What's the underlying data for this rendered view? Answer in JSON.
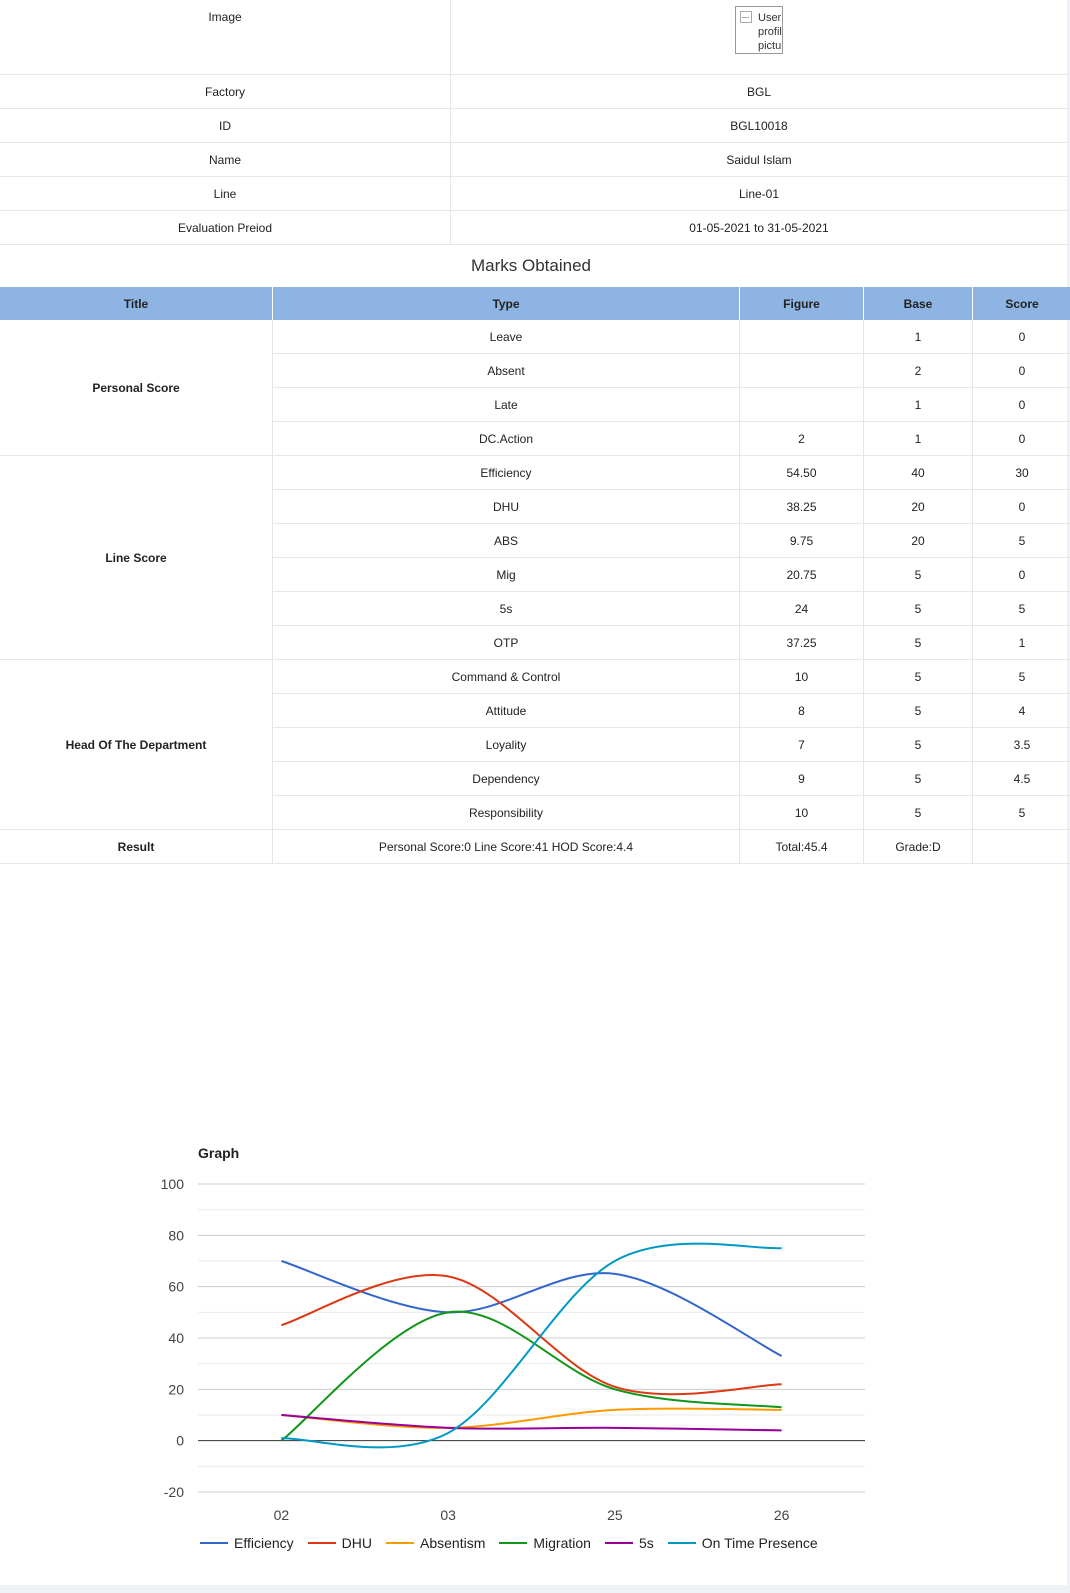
{
  "info": {
    "rows": [
      {
        "key": "Image",
        "value": "User profile picture",
        "image": true
      },
      {
        "key": "Factory",
        "value": "BGL"
      },
      {
        "key": "ID",
        "value": "BGL10018"
      },
      {
        "key": "Name",
        "value": "Saidul Islam"
      },
      {
        "key": "Line",
        "value": "Line-01"
      },
      {
        "key": "Evaluation Preiod",
        "value": "01-05-2021 to 31-05-2021"
      }
    ]
  },
  "marks": {
    "title": "Marks Obtained",
    "headers": [
      "Title",
      "Type",
      "Figure",
      "Base",
      "Score"
    ],
    "groups": [
      {
        "title": "Personal Score",
        "rows": [
          [
            "Leave",
            "",
            "1",
            "0"
          ],
          [
            "Absent",
            "",
            "2",
            "0"
          ],
          [
            "Late",
            "",
            "1",
            "0"
          ],
          [
            "DC.Action",
            "2",
            "1",
            "0"
          ]
        ]
      },
      {
        "title": "Line Score",
        "rows": [
          [
            "Efficiency",
            "54.50",
            "40",
            "30"
          ],
          [
            "DHU",
            "38.25",
            "20",
            "0"
          ],
          [
            "ABS",
            "9.75",
            "20",
            "5"
          ],
          [
            "Mig",
            "20.75",
            "5",
            "0"
          ],
          [
            "5s",
            "24",
            "5",
            "5"
          ],
          [
            "OTP",
            "37.25",
            "5",
            "1"
          ]
        ]
      },
      {
        "title": "Head Of The Department",
        "rows": [
          [
            "Command & Control",
            "10",
            "5",
            "5"
          ],
          [
            "Attitude",
            "8",
            "5",
            "4"
          ],
          [
            "Loyality",
            "7",
            "5",
            "3.5"
          ],
          [
            "Dependency",
            "9",
            "5",
            "4.5"
          ],
          [
            "Responsibility",
            "10",
            "5",
            "5"
          ]
        ]
      }
    ],
    "result": {
      "title": "Result",
      "summary": "Personal Score:0  Line Score:41  HOD Score:4.4",
      "total": "Total:45.4",
      "grade": "Grade:D",
      "score": ""
    }
  },
  "chart_data": {
    "type": "line",
    "title": "Graph",
    "xlabel": "",
    "ylabel": "",
    "categories": [
      "02",
      "03",
      "25",
      "26"
    ],
    "ylim": [
      -20,
      100
    ],
    "yticks": [
      -20,
      0,
      20,
      40,
      60,
      80,
      100
    ],
    "grid": true,
    "smooth": true,
    "legend_position": "bottom",
    "series": [
      {
        "name": "Efficiency",
        "color": "#3366cc",
        "values": [
          70,
          50,
          65,
          33
        ]
      },
      {
        "name": "DHU",
        "color": "#dc3912",
        "values": [
          45,
          64,
          21,
          22
        ]
      },
      {
        "name": "Absentism",
        "color": "#ff9900",
        "values": [
          10,
          5,
          12,
          12
        ]
      },
      {
        "name": "Migration",
        "color": "#109618",
        "values": [
          0,
          50,
          20,
          13
        ]
      },
      {
        "name": "5s",
        "color": "#990099",
        "values": [
          10,
          5,
          5,
          4
        ]
      },
      {
        "name": "On Time Presence",
        "color": "#0099c6",
        "values": [
          1,
          3,
          70,
          75
        ]
      }
    ]
  }
}
